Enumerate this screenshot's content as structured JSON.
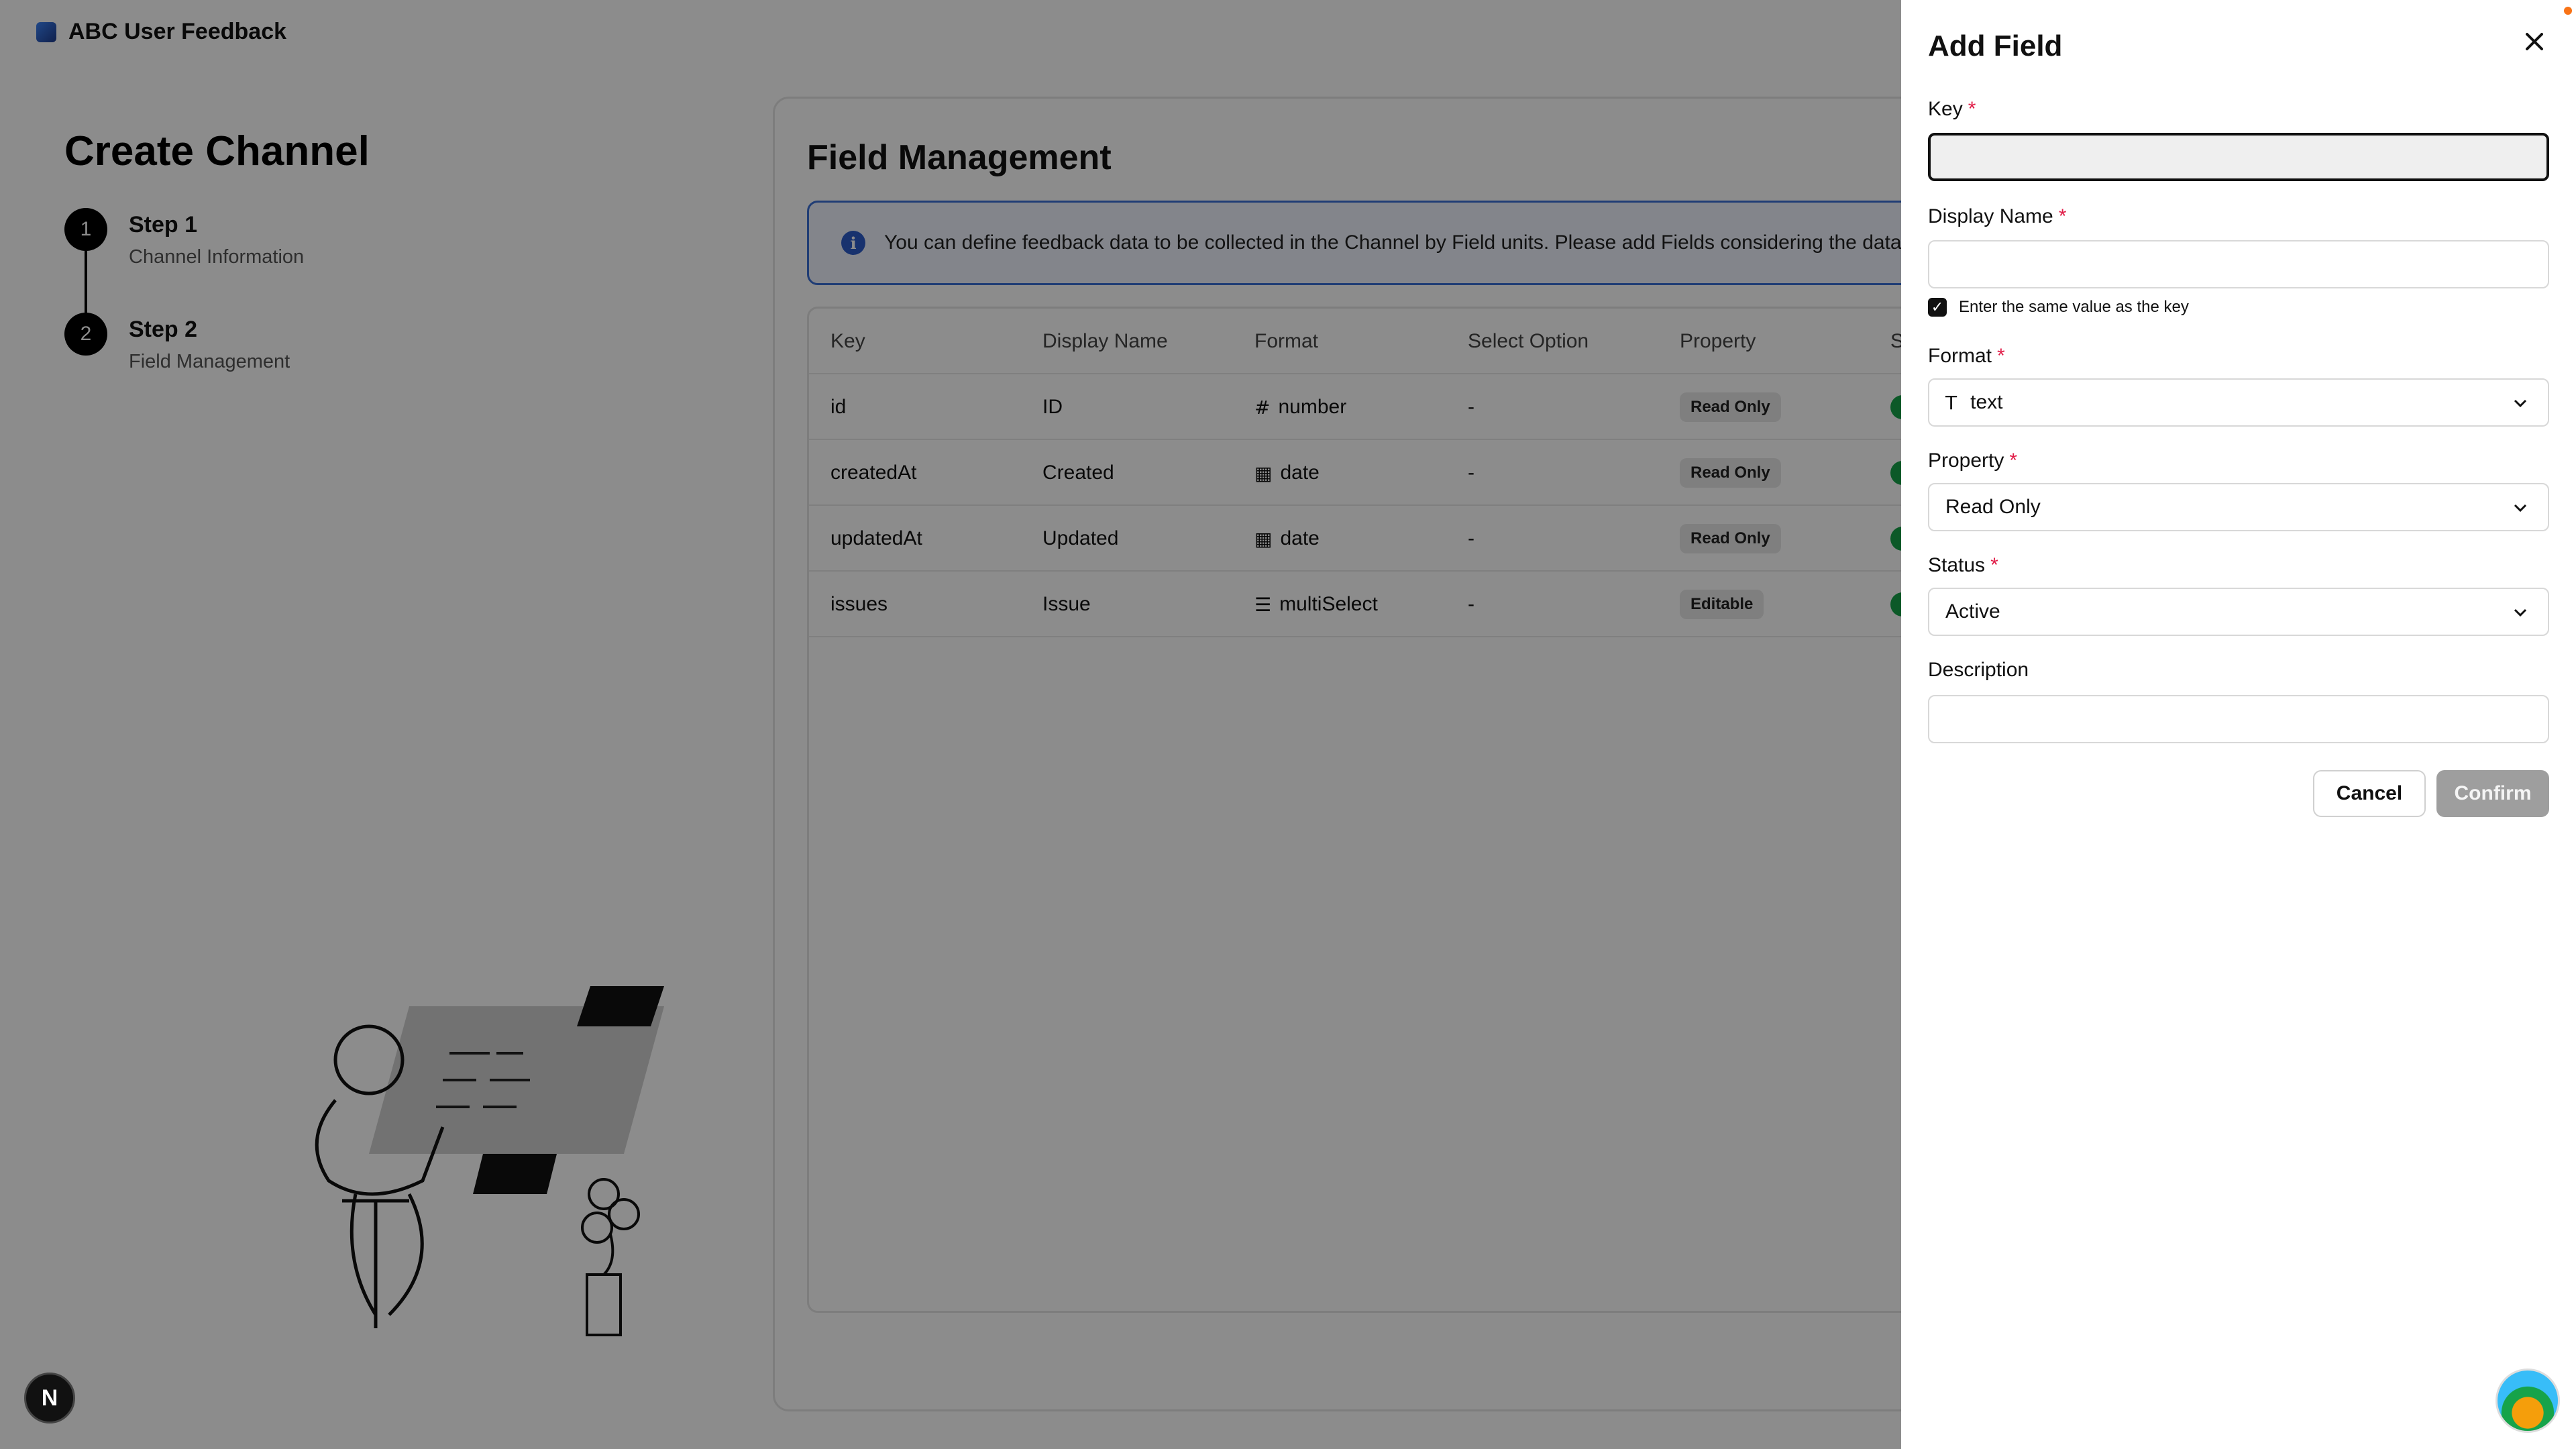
{
  "app": {
    "name": "ABC User Feedback"
  },
  "sidebar": {
    "title": "Create Channel",
    "steps": [
      {
        "number": "1",
        "title": "Step 1",
        "subtitle": "Channel Information"
      },
      {
        "number": "2",
        "title": "Step 2",
        "subtitle": "Field Management"
      }
    ]
  },
  "field_management": {
    "title": "Field Management",
    "info": "You can define feedback data to be collected in the Channel by Field units. Please add Fields considering the data",
    "columns": [
      "Key",
      "Display Name",
      "Format",
      "Select Option",
      "Property",
      "S"
    ],
    "rows": [
      {
        "key": "id",
        "display_name": "ID",
        "format_icon": "#",
        "format": "number",
        "select_option": "-",
        "property": "Read Only"
      },
      {
        "key": "createdAt",
        "display_name": "Created",
        "format_icon": "▦",
        "format": "date",
        "select_option": "-",
        "property": "Read Only"
      },
      {
        "key": "updatedAt",
        "display_name": "Updated",
        "format_icon": "▦",
        "format": "date",
        "select_option": "-",
        "property": "Read Only"
      },
      {
        "key": "issues",
        "display_name": "Issue",
        "format_icon": "☰",
        "format": "multiSelect",
        "select_option": "-",
        "property": "Editable"
      }
    ]
  },
  "drawer": {
    "title": "Add Field",
    "close_icon": "close-icon",
    "key": {
      "label": "Key",
      "required": "*",
      "value": ""
    },
    "display_name": {
      "label": "Display Name",
      "required": "*",
      "value": ""
    },
    "same_as_key": {
      "label": "Enter the same value as the key",
      "checked": true
    },
    "format": {
      "label": "Format",
      "required": "*",
      "icon": "T",
      "value": "text"
    },
    "property": {
      "label": "Property",
      "required": "*",
      "value": "Read Only"
    },
    "status": {
      "label": "Status",
      "required": "*",
      "value": "Active"
    },
    "description": {
      "label": "Description",
      "value": ""
    },
    "cancel_label": "Cancel",
    "confirm_label": "Confirm"
  },
  "dev_badge": "N",
  "colors": {
    "accent_blue": "#3b6fd6",
    "status_green": "#16a34a",
    "required_red": "#e11d48"
  }
}
